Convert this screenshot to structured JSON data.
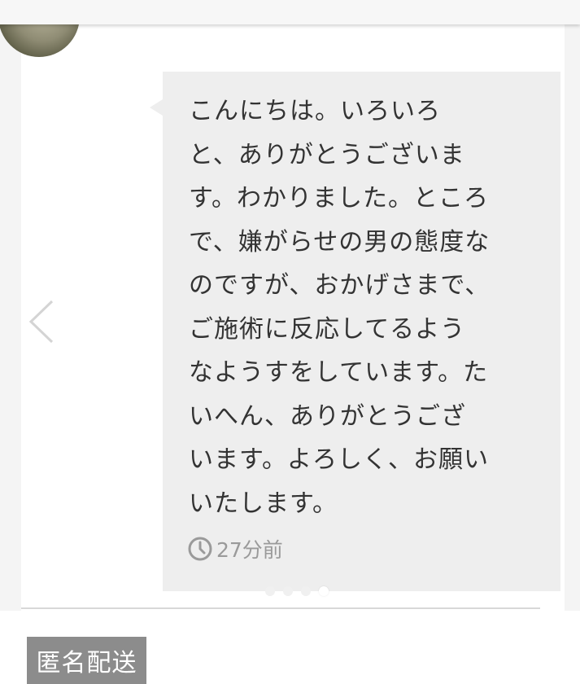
{
  "message": {
    "lines": [
      "こんにちは。いろいろ",
      "と、ありがとうございま",
      "す。わかりました。ところ",
      "で、嫌がらせの男の態度な",
      "のですが、おかげさまで、",
      "ご施術に反応してるよう",
      "なようすをしています。た",
      "いへん、ありがとうござ",
      "います。よろしく、お願い",
      "いたします。"
    ],
    "timestamp": "27分前",
    "timestamp_icon": "clock-icon"
  },
  "carousel": {
    "prev_icon": "chevron-left-icon",
    "dot_count": 4,
    "active_dot": 4
  },
  "tags": {
    "shipping": "匿名配送"
  },
  "colors": {
    "bubble_bg": "#eeeeee",
    "text": "#333333",
    "timestamp": "#9a9a9a",
    "tag_bg": "#8c8c8c",
    "tag_text": "#ffffff"
  }
}
